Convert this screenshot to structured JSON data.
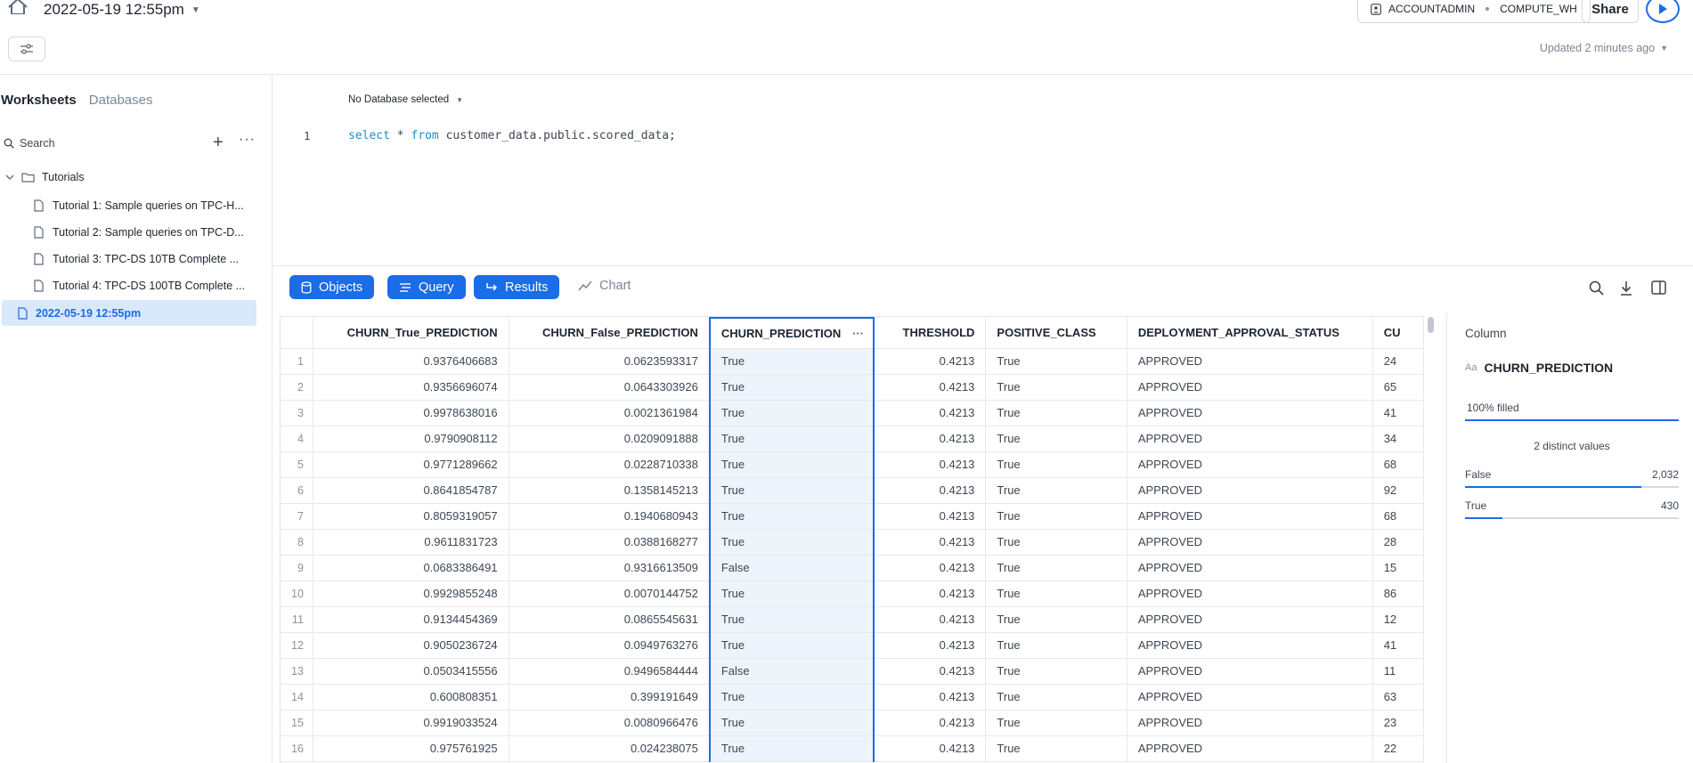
{
  "header": {
    "worksheet_title": "2022-05-19 12:55pm",
    "role": "ACCOUNTADMIN",
    "warehouse": "COMPUTE_WH",
    "share_label": "Share",
    "updated_text": "Updated 2 minutes ago"
  },
  "sidebar": {
    "tab_worksheets": "Worksheets",
    "tab_databases": "Databases",
    "search_label": "Search",
    "folder": "Tutorials",
    "items": [
      "Tutorial 1: Sample queries on TPC-H...",
      "Tutorial 2: Sample queries on TPC-D...",
      "Tutorial 3: TPC-DS 10TB Complete ...",
      "Tutorial 4: TPC-DS 100TB Complete ..."
    ],
    "selected_item": "2022-05-19 12:55pm"
  },
  "editor": {
    "database_selector": "No Database selected",
    "line_number": "1",
    "code_kw1": "select",
    "code_mid": " * ",
    "code_kw2": "from",
    "code_rest": " customer_data.public.scored_data;"
  },
  "results_toolbar": {
    "objects": "Objects",
    "query": "Query",
    "results": "Results",
    "chart": "Chart"
  },
  "grid": {
    "columns": [
      "CHURN_True_PREDICTION",
      "CHURN_False_PREDICTION",
      "CHURN_PREDICTION",
      "THRESHOLD",
      "POSITIVE_CLASS",
      "DEPLOYMENT_APPROVAL_STATUS",
      "CU"
    ],
    "rows": [
      [
        "1",
        "0.9376406683",
        "0.0623593317",
        "True",
        "0.4213",
        "True",
        "APPROVED",
        "24"
      ],
      [
        "2",
        "0.9356696074",
        "0.0643303926",
        "True",
        "0.4213",
        "True",
        "APPROVED",
        "65"
      ],
      [
        "3",
        "0.9978638016",
        "0.0021361984",
        "True",
        "0.4213",
        "True",
        "APPROVED",
        "41"
      ],
      [
        "4",
        "0.9790908112",
        "0.0209091888",
        "True",
        "0.4213",
        "True",
        "APPROVED",
        "34"
      ],
      [
        "5",
        "0.9771289662",
        "0.0228710338",
        "True",
        "0.4213",
        "True",
        "APPROVED",
        "68"
      ],
      [
        "6",
        "0.8641854787",
        "0.1358145213",
        "True",
        "0.4213",
        "True",
        "APPROVED",
        "92"
      ],
      [
        "7",
        "0.8059319057",
        "0.1940680943",
        "True",
        "0.4213",
        "True",
        "APPROVED",
        "68"
      ],
      [
        "8",
        "0.9611831723",
        "0.0388168277",
        "True",
        "0.4213",
        "True",
        "APPROVED",
        "28"
      ],
      [
        "9",
        "0.0683386491",
        "0.9316613509",
        "False",
        "0.4213",
        "True",
        "APPROVED",
        "15"
      ],
      [
        "10",
        "0.9929855248",
        "0.0070144752",
        "True",
        "0.4213",
        "True",
        "APPROVED",
        "86"
      ],
      [
        "11",
        "0.9134454369",
        "0.0865545631",
        "True",
        "0.4213",
        "True",
        "APPROVED",
        "12"
      ],
      [
        "12",
        "0.9050236724",
        "0.0949763276",
        "True",
        "0.4213",
        "True",
        "APPROVED",
        "41"
      ],
      [
        "13",
        "0.0503415556",
        "0.9496584444",
        "False",
        "0.4213",
        "True",
        "APPROVED",
        "11"
      ],
      [
        "14",
        "0.600808351",
        "0.399191649",
        "True",
        "0.4213",
        "True",
        "APPROVED",
        "63"
      ],
      [
        "15",
        "0.9919033524",
        "0.0080966476",
        "True",
        "0.4213",
        "True",
        "APPROVED",
        "23"
      ],
      [
        "16",
        "0.975761925",
        "0.024238075",
        "True",
        "0.4213",
        "True",
        "APPROVED",
        "22"
      ]
    ]
  },
  "column_panel": {
    "title": "Column",
    "type_icon": "Aa",
    "column_name": "CHURN_PREDICTION",
    "filled": "100% filled",
    "distinct": "2 distinct values",
    "values": [
      {
        "label": "False",
        "count": "2,032",
        "fraction": 0.825
      },
      {
        "label": "True",
        "count": "430",
        "fraction": 0.175
      }
    ]
  },
  "colors": {
    "accent": "#1a6ce7",
    "selected_bg": "#d9e8fb"
  }
}
